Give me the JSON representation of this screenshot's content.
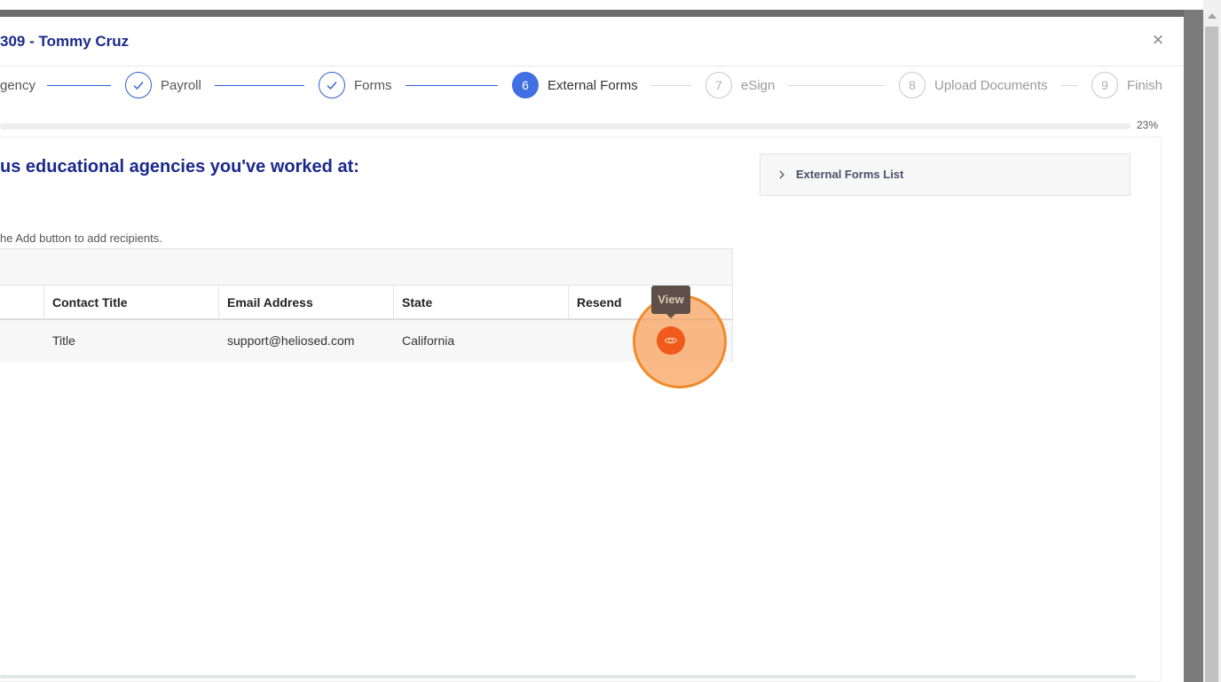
{
  "modal": {
    "title": "309 - Tommy Cruz",
    "close_label": "×"
  },
  "stepper": {
    "steps": [
      {
        "label": "gency",
        "number": "",
        "status": "done"
      },
      {
        "label": "Payroll",
        "number": "",
        "status": "done"
      },
      {
        "label": "Forms",
        "number": "",
        "status": "done"
      },
      {
        "label": "External Forms",
        "number": "6",
        "status": "active"
      },
      {
        "label": "eSign",
        "number": "7",
        "status": "pending"
      },
      {
        "label": "Upload Documents",
        "number": "8",
        "status": "pending"
      },
      {
        "label": "Finish",
        "number": "9",
        "status": "pending"
      }
    ],
    "progress_text": "23%",
    "progress_value": 0.23
  },
  "section": {
    "heading": "us educational agencies you've worked at:",
    "hint": "he Add button to add recipients."
  },
  "table": {
    "headers": [
      "Contact Title",
      "Email Address",
      "State",
      "Resend"
    ],
    "rows": [
      {
        "contact_title": "Title",
        "email": "support@heliosed.com",
        "state": "California"
      }
    ]
  },
  "tooltip": {
    "text": "View"
  },
  "sidebar": {
    "accordion_label": "External Forms List"
  },
  "icons": {
    "view": "eye-icon",
    "close": "close-icon",
    "check": "check-icon",
    "chevron": "chevron-right-icon"
  },
  "colors": {
    "accent": "#3f6fe0",
    "title": "#1b2a8c",
    "view_button": "#f05a1a",
    "highlight": "#f18a2a"
  }
}
